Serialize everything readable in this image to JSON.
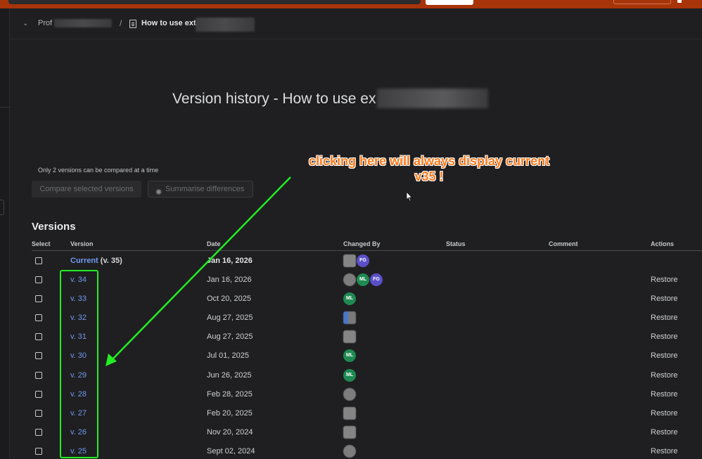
{
  "breadcrumb": {
    "space_prefix": "Prof",
    "page_prefix": "How to use ext"
  },
  "page_title": "Version history - How to use ex",
  "compare": {
    "note": "Only 2 versions can be compared at a time",
    "compare_button": "Compare selected versions",
    "summarise_button": "Summarise differences"
  },
  "annotation": {
    "line1": "clicking here will always display current",
    "line2": "v35 !",
    "arrow_color": "#22ee22",
    "text_color": "#ff7a1a"
  },
  "versions": {
    "heading": "Versions",
    "columns": [
      "Select",
      "Version",
      "Date",
      "Changed By",
      "Status",
      "Comment",
      "Actions"
    ],
    "current": {
      "label": "Current",
      "suffix": "(v. 35)",
      "date": "Jan 16, 2026",
      "avatars": [
        "photo",
        "FG"
      ]
    },
    "rows": [
      {
        "version": "v. 34",
        "date": "Jan 16, 2026",
        "action": "Restore",
        "avatars": [
          "photo-round",
          "ML",
          "FG"
        ]
      },
      {
        "version": "v. 33",
        "date": "Oct 20, 2025",
        "action": "Restore",
        "avatars": [
          "ML"
        ]
      },
      {
        "version": "v. 32",
        "date": "Aug 27, 2025",
        "action": "Restore",
        "avatars": [
          "photo-blue"
        ]
      },
      {
        "version": "v. 31",
        "date": "Aug 27, 2025",
        "action": "Restore",
        "avatars": [
          "photo"
        ]
      },
      {
        "version": "v. 30",
        "date": "Jul 01, 2025",
        "action": "Restore",
        "avatars": [
          "ML"
        ]
      },
      {
        "version": "v. 29",
        "date": "Jun 26, 2025",
        "action": "Restore",
        "avatars": [
          "ML"
        ]
      },
      {
        "version": "v. 28",
        "date": "Feb 28, 2025",
        "action": "Restore",
        "avatars": [
          "photo-round"
        ]
      },
      {
        "version": "v. 27",
        "date": "Feb 20, 2025",
        "action": "Restore",
        "avatars": [
          "photo"
        ]
      },
      {
        "version": "v. 26",
        "date": "Nov 20, 2024",
        "action": "Restore",
        "avatars": [
          "photo"
        ]
      },
      {
        "version": "v. 25",
        "date": "Sept 02, 2024",
        "action": "Restore",
        "avatars": [
          "photo-round"
        ]
      }
    ]
  },
  "colors": {
    "topbar": "#a8340a",
    "background": "#1f1f21",
    "link": "#6f9af0"
  }
}
